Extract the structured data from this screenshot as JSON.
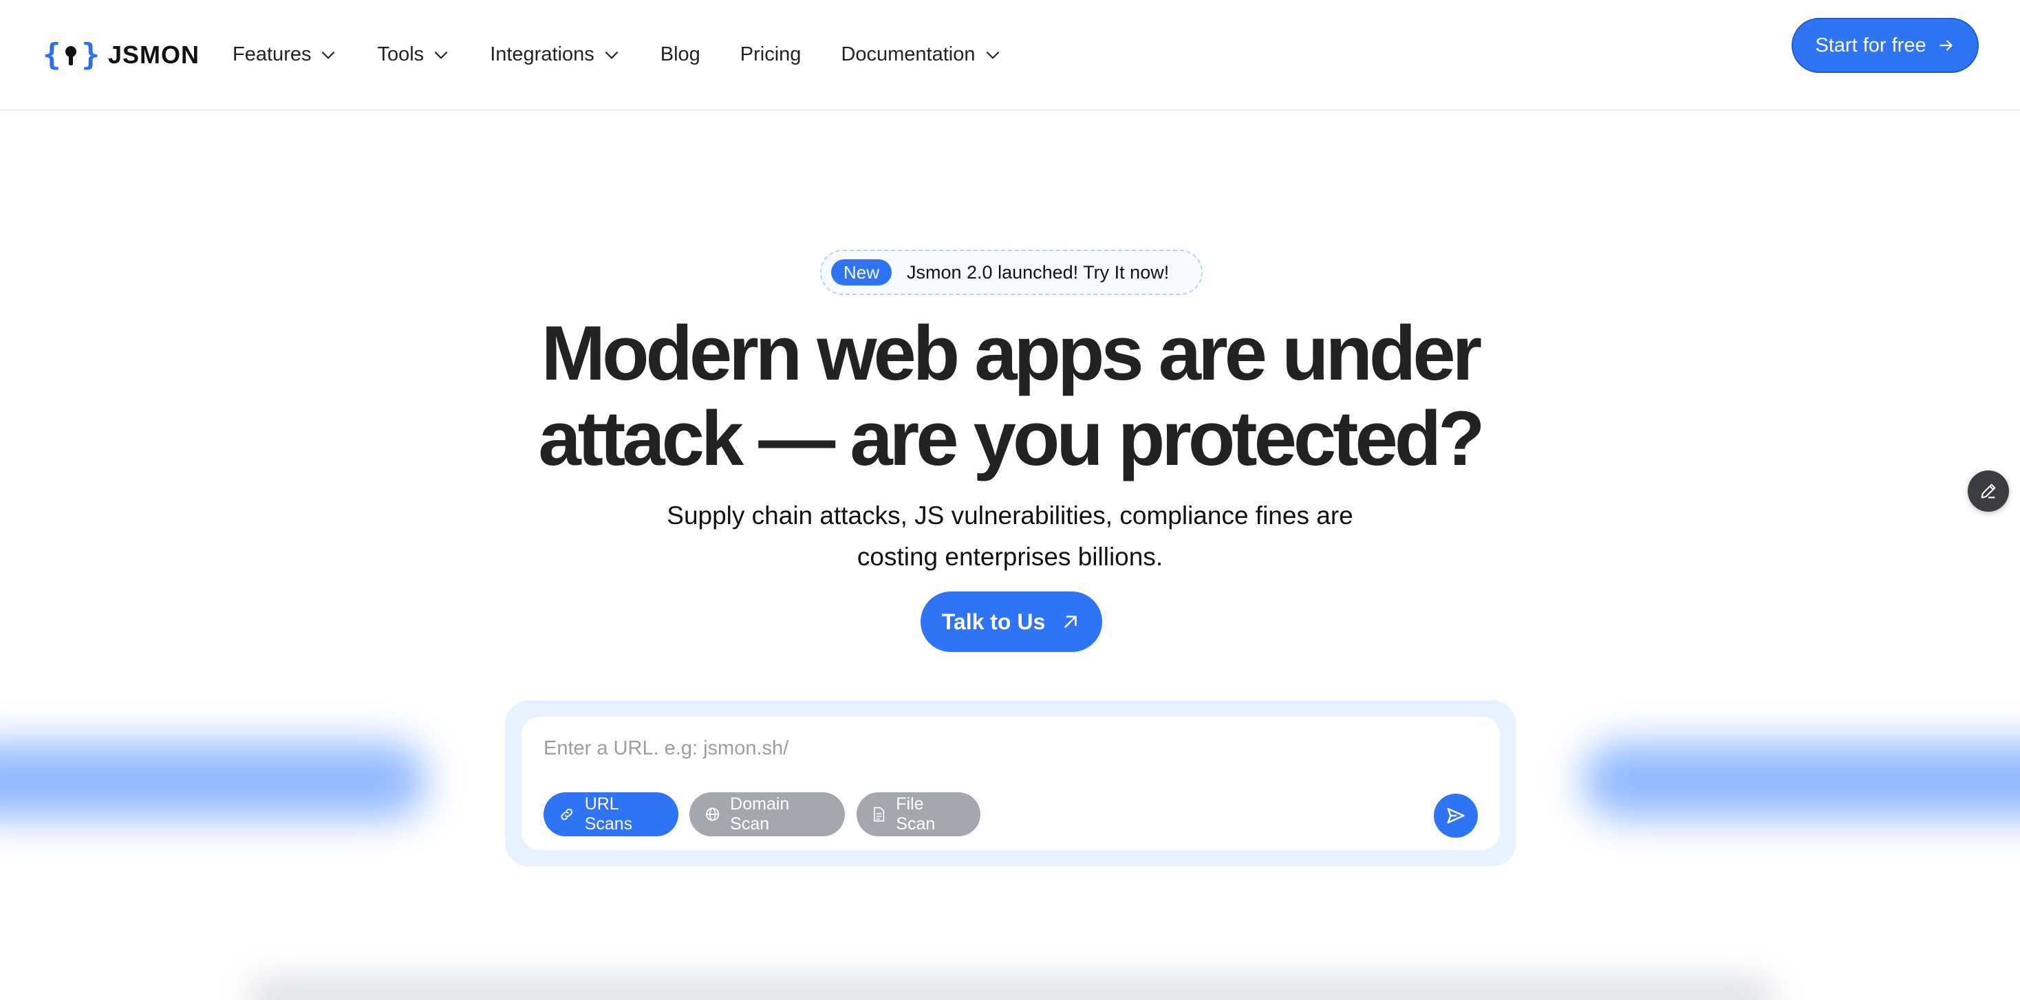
{
  "brand": {
    "name": "JSMON",
    "accent": "#2f74f5"
  },
  "nav": {
    "items": [
      {
        "label": "Features",
        "dropdown": true
      },
      {
        "label": "Tools",
        "dropdown": true
      },
      {
        "label": "Integrations",
        "dropdown": true
      },
      {
        "label": "Blog",
        "dropdown": false
      },
      {
        "label": "Pricing",
        "dropdown": false
      },
      {
        "label": "Documentation",
        "dropdown": true
      }
    ],
    "cta_label": "Start for free"
  },
  "badge": {
    "pill": "New",
    "text": "Jsmon 2.0 launched! Try It now!"
  },
  "hero": {
    "title_line1": "Modern web apps are under",
    "title_line2": "attack — are you protected?",
    "subtitle_line1": "Supply chain attacks, JS vulnerabilities, compliance fines are",
    "subtitle_line2": "costing enterprises billions.",
    "cta_label": "Talk to Us"
  },
  "scanner": {
    "placeholder": "Enter a URL. e.g: jsmon.sh/",
    "value": "",
    "modes": [
      {
        "label": "URL Scans",
        "icon": "link-icon",
        "active": true
      },
      {
        "label": "Domain Scan",
        "icon": "globe-icon",
        "active": false
      },
      {
        "label": "File Scan",
        "icon": "file-icon",
        "active": false
      }
    ],
    "submit_icon": "send-icon"
  },
  "floating": {
    "icon": "pencil-icon"
  }
}
